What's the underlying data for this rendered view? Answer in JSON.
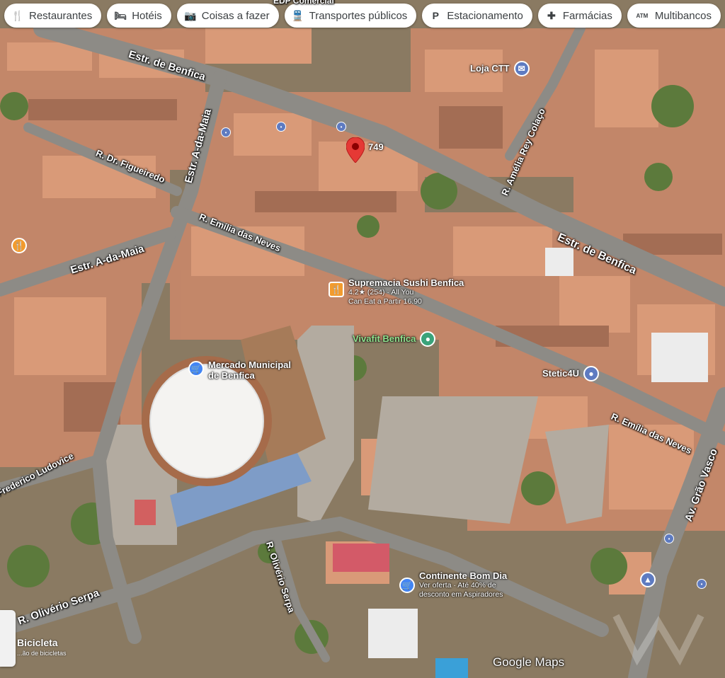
{
  "chips": [
    {
      "icon": "fork-knife-icon",
      "glyph": "🍴",
      "label": "Restaurantes"
    },
    {
      "icon": "bed-icon",
      "glyph": "🛏",
      "label": "Hotéis"
    },
    {
      "icon": "camera-icon",
      "glyph": "📷",
      "label": "Coisas a fazer"
    },
    {
      "icon": "bus-icon",
      "glyph": "🚆",
      "label": "Transportes públicos"
    },
    {
      "icon": "parking-icon",
      "glyph": "P",
      "label": "Estacionamento"
    },
    {
      "icon": "pharmacy-icon",
      "glyph": "✚",
      "label": "Farmácias"
    },
    {
      "icon": "atm-icon",
      "glyph": "ATM",
      "label": "Multibancos"
    }
  ],
  "streets": {
    "top_partial": "EDP Comercial",
    "estr_benfica_1": "Estr. de Benfica",
    "estr_benfica_2": "Estr. de Benfica",
    "estr_a_da_maia_v": "Estr. A-da-Maia",
    "estr_a_da_maia_h": "Estr. A-da-Maia",
    "dr_figueiredo": "R. Dr. Figueiredo",
    "emilia_neves_1": "R. Emília das Neves",
    "emilia_neves_2": "R. Emília das Neves",
    "amelia_rey": "R. Amélia Rey Colaço",
    "federico": "Frederico Ludovice",
    "oliverio_serpa_1": "R. Olivério Serpa",
    "oliverio_serpa_2": "R. Olivério Serpa",
    "grao_vasco": "Av. Grão Vasco"
  },
  "pois": {
    "loja_ctt": {
      "name": "Loja CTT",
      "color": "#5e7bc1"
    },
    "sushi": {
      "name": "Supremacia Sushi Benfica",
      "sub1": "4.2★ (254) · All You",
      "sub2": "Can Eat a Partir 16.90",
      "color": "#f29b2e"
    },
    "vivafit": {
      "name": "Vivafit Benfica",
      "color": "#3aa37a"
    },
    "stetic": {
      "name": "Stetic4U",
      "color": "#5e7bc1"
    },
    "mercado": {
      "name1": "Mercado Municipal",
      "name2": "de Benfica",
      "color": "#4285f4"
    },
    "continente": {
      "name": "Continente Bom Dia",
      "sub1": "Ver oferta · Até 40% de",
      "sub2": "desconto em Aspiradores",
      "color": "#4285f4"
    }
  },
  "pin": {
    "label": "749",
    "color": "#e53935"
  },
  "bike": {
    "label": "Bicicleta",
    "sub": "...ão de bicicletas"
  },
  "attribution": "Google Maps"
}
